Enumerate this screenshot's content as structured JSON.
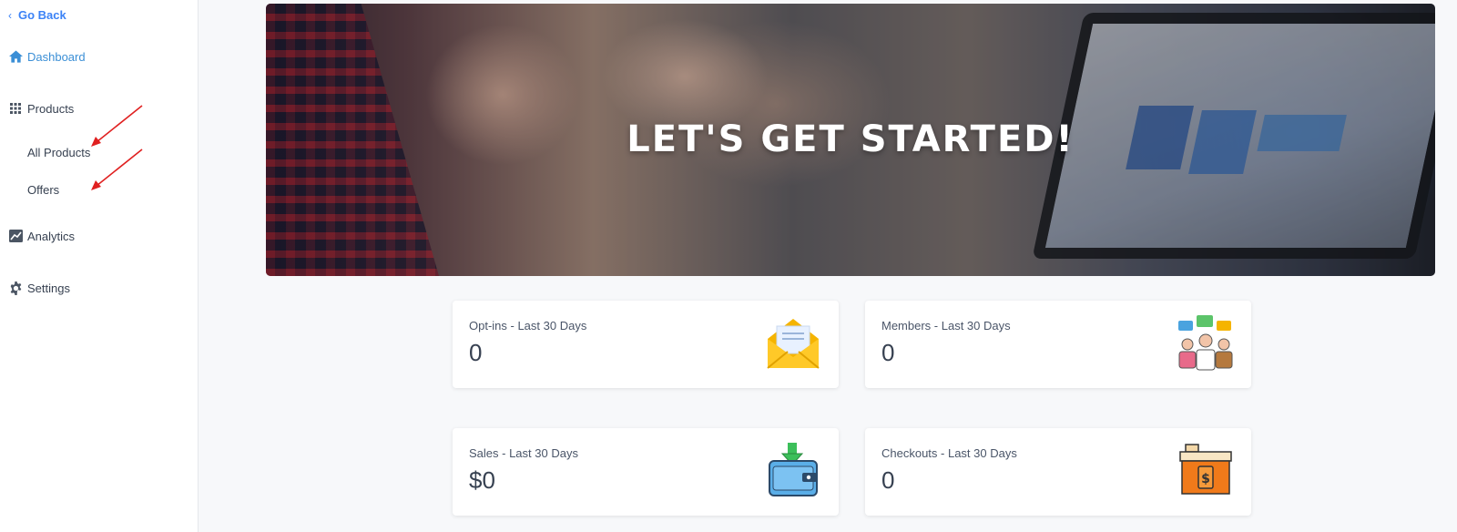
{
  "sidebar": {
    "go_back": "Go Back",
    "items": [
      {
        "label": "Dashboard",
        "icon": "home-icon"
      },
      {
        "label": "Products",
        "icon": "grid-icon"
      },
      {
        "label": "Analytics",
        "icon": "chart-icon"
      },
      {
        "label": "Settings",
        "icon": "gear-icon"
      }
    ],
    "sub_items": [
      {
        "label": "All Products"
      },
      {
        "label": "Offers"
      }
    ]
  },
  "hero": {
    "title": "LET'S GET STARTED!"
  },
  "stats": [
    {
      "label": "Opt-ins - Last 30 Days",
      "value": "0",
      "icon": "envelope-icon"
    },
    {
      "label": "Members - Last 30 Days",
      "value": "0",
      "icon": "members-icon"
    },
    {
      "label": "Sales - Last 30 Days",
      "value": "$0",
      "icon": "wallet-icon"
    },
    {
      "label": "Checkouts - Last 30 Days",
      "value": "0",
      "icon": "register-icon"
    }
  ],
  "colors": {
    "accent": "#3b82f6",
    "annotation_arrow": "#e02020"
  }
}
